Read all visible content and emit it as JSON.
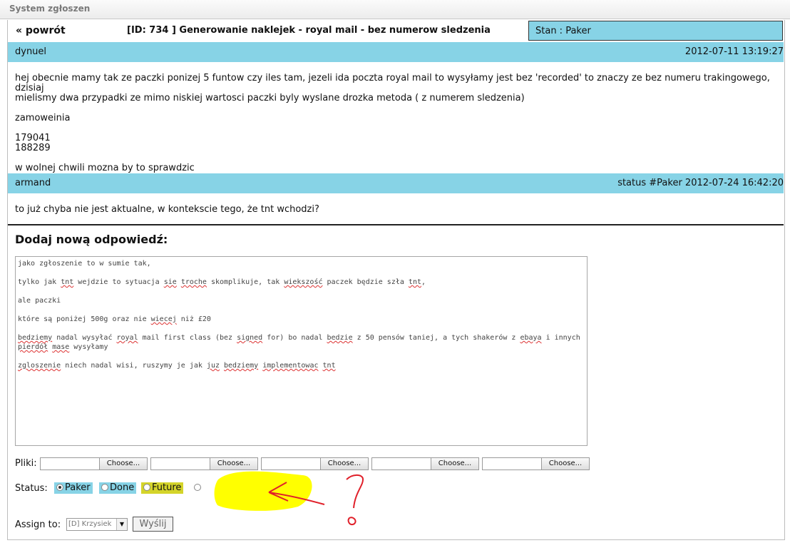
{
  "app": {
    "title": "System zgłoszen"
  },
  "ticket": {
    "back_label": "« powrót",
    "title": "[ID: 734 ] Generowanie naklejek - royal mail - bez numerow sledzenia",
    "state_label": "Stan : Paker"
  },
  "messages": [
    {
      "author": "dynuel",
      "meta": "2012-07-11 13:19:27",
      "body": "hej obecnie mamy tak ze paczki ponizej 5 funtow czy iles tam, jezeli ida poczta royal mail to wysyłamy jest bez 'recorded' to znaczy ze bez numeru trakingowego, dzisiaj\nmielismy dwa przypadki ze mimo niskiej wartosci paczki byly wyslane drozka metoda ( z numerem sledzenia)\n\nzamoweinia\n\n179041\n188289\n\nw wolnej chwili mozna by to sprawdzic"
    },
    {
      "author": "armand",
      "meta": "status #Paker 2012-07-24 16:42:20",
      "body": "to już chyba nie jest aktualne, w kontekscie tego, że tnt wchodzi?"
    }
  ],
  "reply": {
    "heading": "Dodaj nową odpowiedź:",
    "text": "jako zgłoszenie to w sumie tak,\n\ntylko jak tnt wejdzie to sytuacja sie troche skomplikuje, tak wiekszość paczek będzie szła tnt,\n\nale paczki\n\nktóre są poniżej 500g oraz nie wiecej niż £20\n\nbedziemy nadal wysyłać royal mail first class (bez signed for) bo nadal bedzie z 50 pensów taniej, a tych shakerów z ebaya i innych\npierdół mase wysyłamy\n\nzgloszenie niech nadal wisi, ruszymy je jak juz bedziemy implementowac tnt"
  },
  "files": {
    "label": "Pliki:",
    "inputs": [
      {
        "button": "Choose..."
      },
      {
        "button": "Choose..."
      },
      {
        "button": "Choose..."
      },
      {
        "button": "Choose..."
      },
      {
        "button": "Choose..."
      }
    ]
  },
  "status": {
    "label": "Status:",
    "options": [
      {
        "label": "Paker",
        "selected": true,
        "color": "#87d3e6"
      },
      {
        "label": "Done",
        "selected": false,
        "color": "#87d3e6"
      },
      {
        "label": "Future",
        "selected": false,
        "color": "#d4d42a"
      },
      {
        "label": "",
        "selected": false,
        "color": "#ffffff"
      }
    ]
  },
  "assign": {
    "label": "Assign to:",
    "selected": "[D] Krzysiek"
  },
  "submit_label": "Wyślij",
  "colors": {
    "header": "#87d3e6",
    "highlight": "#ffff00",
    "annotation": "#e0202a"
  }
}
